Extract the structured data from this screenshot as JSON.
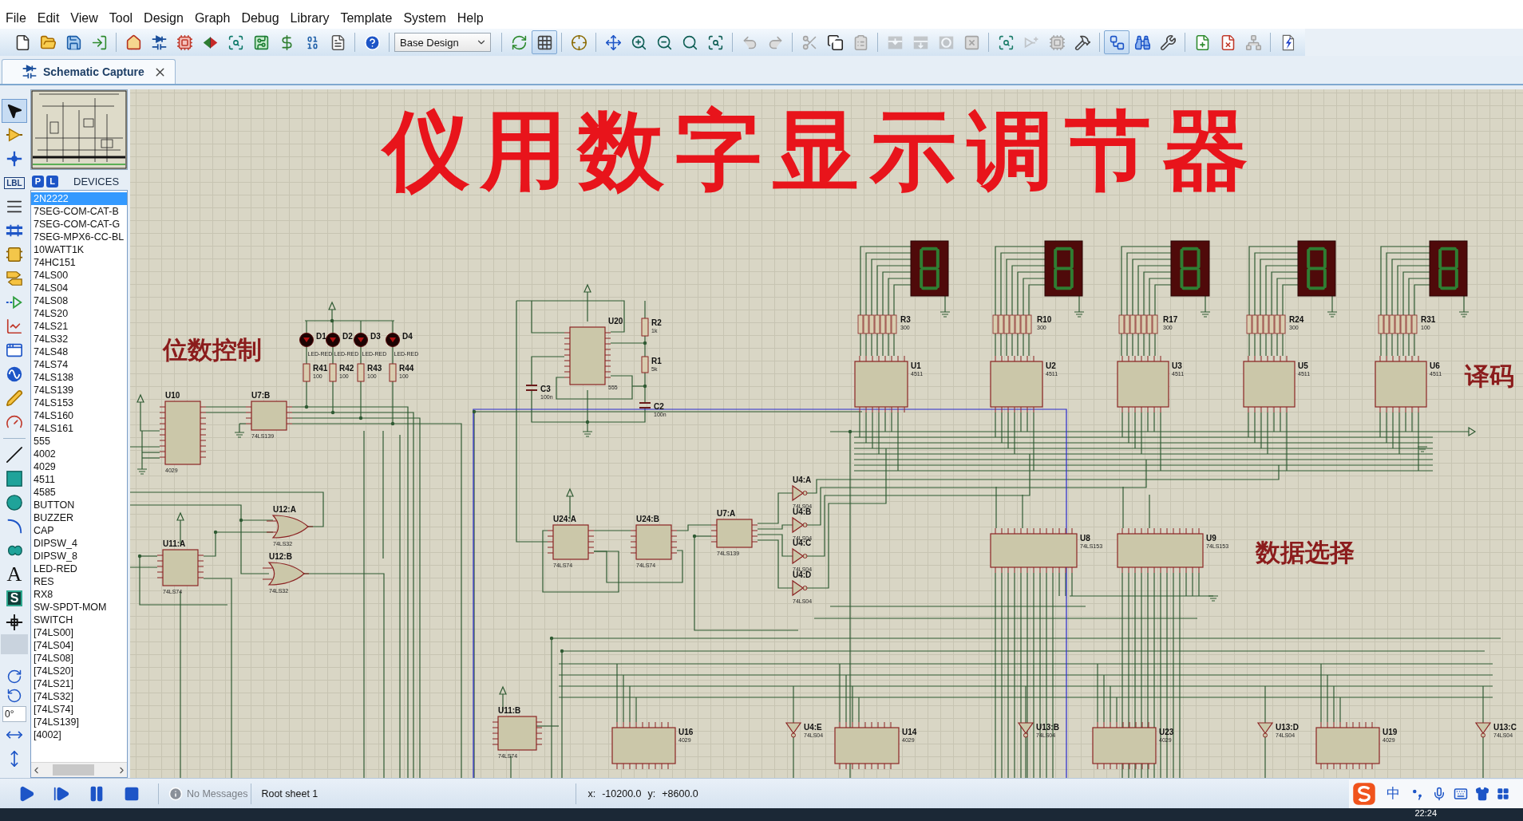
{
  "menu": [
    "File",
    "Edit",
    "View",
    "Tool",
    "Design",
    "Graph",
    "Debug",
    "Library",
    "Template",
    "System",
    "Help"
  ],
  "toolbar": [
    [
      {
        "kind": "new_file",
        "selected": false,
        "disabled": false
      },
      {
        "kind": "open",
        "selected": false,
        "disabled": false
      },
      {
        "kind": "save",
        "selected": false,
        "disabled": false
      },
      {
        "kind": "import",
        "selected": false,
        "disabled": false
      }
    ],
    [
      {
        "kind": "home",
        "selected": false,
        "disabled": false
      },
      {
        "kind": "schematic",
        "selected": false,
        "disabled": false
      },
      {
        "kind": "pcb",
        "selected": false,
        "disabled": false
      },
      {
        "kind": "visualizer",
        "selected": false,
        "disabled": false
      },
      {
        "kind": "gerber",
        "selected": false,
        "disabled": false
      },
      {
        "kind": "explorer",
        "selected": false,
        "disabled": false
      },
      {
        "kind": "bom",
        "selected": false,
        "disabled": false
      },
      {
        "kind": "binary",
        "selected": false,
        "disabled": false
      },
      {
        "kind": "notes",
        "selected": false,
        "disabled": false
      }
    ],
    [
      {
        "kind": "help",
        "selected": false,
        "disabled": false
      }
    ],
    [
      {
        "kind": "dropdown",
        "value": "Base Design"
      }
    ],
    [
      {
        "kind": "refresh",
        "selected": false,
        "disabled": false
      },
      {
        "kind": "grid",
        "selected": true,
        "disabled": false
      }
    ],
    [
      {
        "kind": "origin",
        "selected": false,
        "disabled": false
      }
    ],
    [
      {
        "kind": "pan",
        "selected": false,
        "disabled": false
      },
      {
        "kind": "zoom_in",
        "selected": false,
        "disabled": false
      },
      {
        "kind": "zoom_out",
        "selected": false,
        "disabled": false
      },
      {
        "kind": "zoom_all",
        "selected": false,
        "disabled": false
      },
      {
        "kind": "zoom_area",
        "selected": false,
        "disabled": false
      }
    ],
    [
      {
        "kind": "undo",
        "selected": false,
        "disabled": true
      },
      {
        "kind": "redo",
        "selected": false,
        "disabled": true
      }
    ],
    [
      {
        "kind": "cut",
        "selected": false,
        "disabled": true
      },
      {
        "kind": "copy",
        "selected": false,
        "disabled": false
      },
      {
        "kind": "paste",
        "selected": false,
        "disabled": true
      }
    ],
    [
      {
        "kind": "block_copy",
        "selected": false,
        "disabled": true
      },
      {
        "kind": "block_move",
        "selected": false,
        "disabled": true
      },
      {
        "kind": "block_rotate",
        "selected": false,
        "disabled": true
      },
      {
        "kind": "block_delete",
        "selected": false,
        "disabled": true
      }
    ],
    [
      {
        "kind": "pick",
        "selected": false,
        "disabled": false
      },
      {
        "kind": "make_device",
        "selected": false,
        "disabled": true
      },
      {
        "kind": "packaging",
        "selected": false,
        "disabled": true
      },
      {
        "kind": "decompose",
        "selected": false,
        "disabled": false
      }
    ],
    [
      {
        "kind": "autorouter",
        "selected": true,
        "disabled": false
      },
      {
        "kind": "search",
        "selected": false,
        "disabled": false
      },
      {
        "kind": "property",
        "selected": false,
        "disabled": false
      }
    ],
    [
      {
        "kind": "new_sheet",
        "selected": false,
        "disabled": false
      },
      {
        "kind": "delete_sheet",
        "selected": false,
        "disabled": false
      },
      {
        "kind": "goto_sheet",
        "selected": false,
        "disabled": true
      }
    ],
    [
      {
        "kind": "erc",
        "disabled": false
      }
    ]
  ],
  "tabs": [
    {
      "label": "Schematic Capture",
      "selected": true
    }
  ],
  "tool_strip": [
    [
      {
        "kind": "select",
        "selected": true
      },
      {
        "kind": "component",
        "selected": false
      },
      {
        "kind": "junction",
        "selected": false
      },
      {
        "kind": "label",
        "text": "LBL",
        "selected": false
      },
      {
        "kind": "script",
        "selected": false
      },
      {
        "kind": "bus",
        "selected": false
      },
      {
        "kind": "subcircuit",
        "selected": false
      },
      {
        "kind": "terminal",
        "selected": false
      },
      {
        "kind": "pin",
        "selected": false
      },
      {
        "kind": "graph",
        "selected": false
      },
      {
        "kind": "recorder",
        "selected": false
      },
      {
        "kind": "generator",
        "selected": false
      },
      {
        "kind": "probe",
        "selected": false
      },
      {
        "kind": "instrument",
        "selected": false
      }
    ],
    [
      {
        "kind": "line",
        "selected": false
      },
      {
        "kind": "box",
        "selected": false
      },
      {
        "kind": "circle",
        "selected": false
      },
      {
        "kind": "arc",
        "selected": false
      },
      {
        "kind": "path",
        "selected": false
      },
      {
        "kind": "text",
        "text": "A",
        "selected": false
      },
      {
        "kind": "symbol",
        "text": "S",
        "selected": false
      },
      {
        "kind": "marker",
        "selected": false
      }
    ],
    [
      {
        "kind": "rotate_cw"
      },
      {
        "kind": "rotate_ccw"
      },
      {
        "kind": "angle",
        "value": "0°"
      },
      {
        "kind": "mirror_h"
      },
      {
        "kind": "mirror_v"
      }
    ]
  ],
  "devices_panel": {
    "picker_buttons": [
      "P",
      "L"
    ],
    "title": "DEVICES",
    "items": [
      {
        "label": "2N2222",
        "selected": true
      },
      {
        "label": "7SEG-COM-CAT-B",
        "selected": false
      },
      {
        "label": "7SEG-COM-CAT-G",
        "selected": false
      },
      {
        "label": "7SEG-MPX6-CC-BL",
        "selected": false
      },
      {
        "label": "10WATT1K",
        "selected": false
      },
      {
        "label": "74HC151",
        "selected": false
      },
      {
        "label": "74LS00",
        "selected": false
      },
      {
        "label": "74LS04",
        "selected": false
      },
      {
        "label": "74LS08",
        "selected": false
      },
      {
        "label": "74LS20",
        "selected": false
      },
      {
        "label": "74LS21",
        "selected": false
      },
      {
        "label": "74LS32",
        "selected": false
      },
      {
        "label": "74LS48",
        "selected": false
      },
      {
        "label": "74LS74",
        "selected": false
      },
      {
        "label": "74LS138",
        "selected": false
      },
      {
        "label": "74LS139",
        "selected": false
      },
      {
        "label": "74LS153",
        "selected": false
      },
      {
        "label": "74LS160",
        "selected": false
      },
      {
        "label": "74LS161",
        "selected": false
      },
      {
        "label": "555",
        "selected": false
      },
      {
        "label": "4002",
        "selected": false
      },
      {
        "label": "4029",
        "selected": false
      },
      {
        "label": "4511",
        "selected": false
      },
      {
        "label": "4585",
        "selected": false
      },
      {
        "label": "BUTTON",
        "selected": false
      },
      {
        "label": "BUZZER",
        "selected": false
      },
      {
        "label": "CAP",
        "selected": false
      },
      {
        "label": "DIPSW_4",
        "selected": false
      },
      {
        "label": "DIPSW_8",
        "selected": false
      },
      {
        "label": "LED-RED",
        "selected": false
      },
      {
        "label": "RES",
        "selected": false
      },
      {
        "label": "RX8",
        "selected": false
      },
      {
        "label": "SW-SPDT-MOM",
        "selected": false
      },
      {
        "label": "SWITCH",
        "selected": false
      },
      {
        "label": "[74LS00]",
        "selected": false
      },
      {
        "label": "[74LS04]",
        "selected": false
      },
      {
        "label": "[74LS08]",
        "selected": false
      },
      {
        "label": "[74LS20]",
        "selected": false
      },
      {
        "label": "[74LS21]",
        "selected": false
      },
      {
        "label": "[74LS32]",
        "selected": false
      },
      {
        "label": "[74LS74]",
        "selected": false
      },
      {
        "label": "[74LS139]",
        "selected": false
      },
      {
        "label": "[4002]",
        "selected": false
      }
    ]
  },
  "schematic": {
    "title": "仪用数字显示调节器",
    "section_labels": [
      "位数控制",
      "数据选择",
      "译码"
    ],
    "components": [
      {
        "kind": "led",
        "ref": "D1",
        "value": "LED-RED"
      },
      {
        "kind": "led",
        "ref": "D2",
        "value": "LED-RED"
      },
      {
        "kind": "led",
        "ref": "D3",
        "value": "LED-RED"
      },
      {
        "kind": "led",
        "ref": "D4",
        "value": "LED-RED"
      },
      {
        "kind": "resistor",
        "ref": "R41",
        "value": "100"
      },
      {
        "kind": "resistor",
        "ref": "R42",
        "value": "100"
      },
      {
        "kind": "resistor",
        "ref": "R43",
        "value": "100"
      },
      {
        "kind": "resistor",
        "ref": "R44",
        "value": "100"
      },
      {
        "kind": "chip",
        "ref": "U10",
        "value": "4029"
      },
      {
        "kind": "chip",
        "ref": "U7:B",
        "value": "74LS139"
      },
      {
        "kind": "chip",
        "ref": "U20",
        "value": "555"
      },
      {
        "kind": "resistor",
        "ref": "R2",
        "value": "1k"
      },
      {
        "kind": "resistor",
        "ref": "R1",
        "value": "5k"
      },
      {
        "kind": "capacitor",
        "ref": "C3",
        "value": "100n"
      },
      {
        "kind": "capacitor",
        "ref": "C2",
        "value": "100n"
      },
      {
        "kind": "chip",
        "ref": "U11:A",
        "value": "74LS74"
      },
      {
        "kind": "or_gate",
        "ref": "U12:A",
        "value": "74LS32"
      },
      {
        "kind": "or_gate",
        "ref": "U12:B",
        "value": "74LS32"
      },
      {
        "kind": "chip",
        "ref": "U24:A",
        "value": "74LS74"
      },
      {
        "kind": "chip",
        "ref": "U24:B",
        "value": "74LS74"
      },
      {
        "kind": "chip",
        "ref": "U7:A",
        "value": "74LS139"
      },
      {
        "kind": "inverter",
        "ref": "U4:A",
        "value": "74LS04"
      },
      {
        "kind": "inverter",
        "ref": "U4:B",
        "value": "74LS04"
      },
      {
        "kind": "inverter",
        "ref": "U4:C",
        "value": "74LS04"
      },
      {
        "kind": "inverter",
        "ref": "U4:D",
        "value": "74LS04"
      },
      {
        "kind": "display"
      },
      {
        "kind": "display"
      },
      {
        "kind": "display"
      },
      {
        "kind": "display"
      },
      {
        "kind": "display"
      },
      {
        "kind": "resistor_array",
        "ref": "R3",
        "value": "300"
      },
      {
        "kind": "resistor_array",
        "ref": "R10",
        "value": "300"
      },
      {
        "kind": "resistor_array",
        "ref": "R17",
        "value": "300"
      },
      {
        "kind": "resistor_array",
        "ref": "R24",
        "value": "300"
      },
      {
        "kind": "resistor_array",
        "ref": "R31",
        "value": "100"
      },
      {
        "kind": "chip",
        "ref": "U1",
        "value": "4511"
      },
      {
        "kind": "chip",
        "ref": "U2",
        "value": "4511"
      },
      {
        "kind": "chip",
        "ref": "U3",
        "value": "4511"
      },
      {
        "kind": "chip",
        "ref": "U5",
        "value": "4511"
      },
      {
        "kind": "chip",
        "ref": "U6",
        "value": "4511"
      },
      {
        "kind": "chip",
        "ref": "U8",
        "value": "74LS153"
      },
      {
        "kind": "chip",
        "ref": "U9",
        "value": "74LS153"
      },
      {
        "kind": "chip",
        "ref": "U11:B",
        "value": "74LS74"
      },
      {
        "kind": "chip",
        "ref": "U16",
        "value": "4029"
      },
      {
        "kind": "inverter",
        "ref": "U4:E",
        "value": "74LS04"
      },
      {
        "kind": "chip",
        "ref": "U14",
        "value": "4029"
      },
      {
        "kind": "inverter",
        "ref": "U13:B",
        "value": "74LS04"
      },
      {
        "kind": "chip",
        "ref": "U23",
        "value": "4029"
      },
      {
        "kind": "inverter",
        "ref": "U13:D",
        "value": "74LS04"
      },
      {
        "kind": "chip",
        "ref": "U19",
        "value": "4029"
      },
      {
        "kind": "inverter",
        "ref": "U13:C",
        "value": "74LS04"
      }
    ]
  },
  "status_bar": {
    "messages": "No Messages",
    "sheet": "Root sheet 1",
    "coordinates": [
      {
        "axis": "x:",
        "value": "-10200.0"
      },
      {
        "axis": "y:",
        "value": "+8600.0"
      }
    ],
    "ime_mode": "中"
  },
  "taskbar": {
    "clock": "22:24"
  }
}
